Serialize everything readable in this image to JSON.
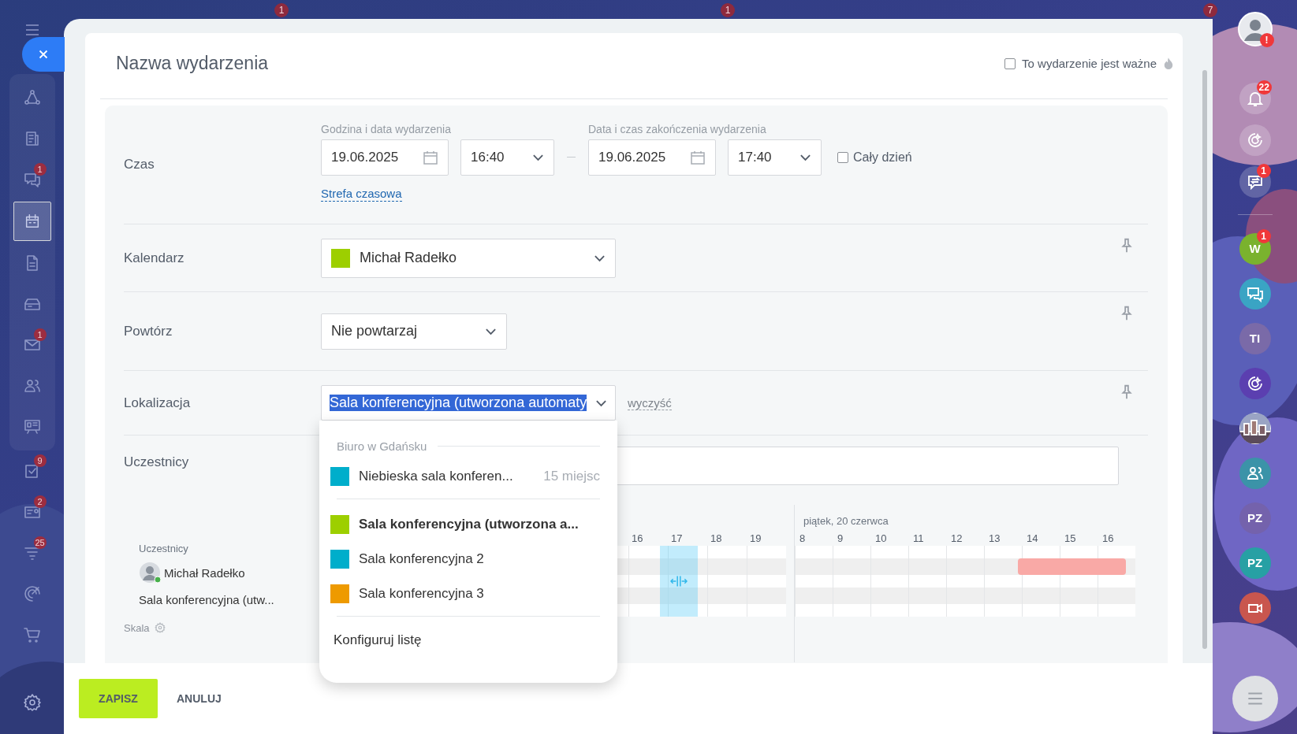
{
  "top_badges": [
    "1",
    "1",
    "7"
  ],
  "left_nav": {
    "items": [
      {
        "kind": "flow",
        "selected": false
      },
      {
        "kind": "feed",
        "selected": false
      },
      {
        "kind": "chat",
        "selected": false,
        "badge": "1"
      },
      {
        "kind": "calendar",
        "selected": true
      },
      {
        "kind": "doc",
        "selected": false
      },
      {
        "kind": "drive",
        "selected": false
      },
      {
        "kind": "mail",
        "selected": false,
        "badge": "1"
      },
      {
        "kind": "people",
        "selected": false
      },
      {
        "kind": "board",
        "selected": false
      },
      {
        "kind": "tasks",
        "selected": false,
        "badge": "9"
      },
      {
        "kind": "card",
        "selected": false,
        "badge": "2"
      },
      {
        "kind": "funnel",
        "selected": false,
        "badge": "25"
      },
      {
        "kind": "target",
        "selected": false
      },
      {
        "kind": "cart",
        "selected": false
      }
    ]
  },
  "event": {
    "title": "Nazwa wydarzenia",
    "important": {
      "label": "To wydarzenie jest ważne",
      "checked": false
    }
  },
  "time": {
    "label": "Czas",
    "start_caption": "Godzina i data wydarzenia",
    "start_date": "19.06.2025",
    "start_time": "16:40",
    "end_caption": "Data i czas zakończenia wydarzenia",
    "end_date": "19.06.2025",
    "end_time": "17:40",
    "all_day": {
      "label": "Cały dzień",
      "checked": false
    },
    "timezone_link": "Strefa czasowa"
  },
  "calendar": {
    "label": "Kalendarz",
    "value": "Michał Radełko",
    "color": "#9dcf00"
  },
  "repeat": {
    "label": "Powtórz",
    "value": "Nie powtarzaj"
  },
  "location": {
    "label": "Lokalizacja",
    "value": "Sala konferencyjna (utworzona automaty",
    "clear": "wyczyść"
  },
  "participants": {
    "label": "Uczestnicy"
  },
  "dropdown": {
    "groups": [
      {
        "title": "Biuro w Gdańsku",
        "items": [
          {
            "name": "Niebieska sala konferen...",
            "capacity": "15 miejsc",
            "color": "#00aecb",
            "selected": false
          }
        ]
      },
      {
        "items": [
          {
            "name": "Sala konferencyjna (utworzona a...",
            "color": "#9dcf00",
            "selected": true
          },
          {
            "name": "Sala konferencyjna 2",
            "color": "#00aecb",
            "selected": false
          },
          {
            "name": "Sala konferencyjna 3",
            "color": "#ee9a00",
            "selected": false
          }
        ]
      }
    ],
    "configure": "Konfiguruj listę"
  },
  "scheduler": {
    "caption": "Uczestnicy",
    "rows": [
      {
        "kind": "person",
        "name": "Michał Radełko"
      },
      {
        "kind": "room",
        "name": "Sala konferencyjna (utw..."
      }
    ],
    "day1_hours": [
      "16",
      "17",
      "18",
      "19"
    ],
    "day2_title": "piątek, 20 czerwca",
    "day2_hours": [
      "8",
      "9",
      "10",
      "11",
      "12",
      "13",
      "14",
      "15",
      "16"
    ],
    "scale_label": "Skala"
  },
  "footer": {
    "save": "ZAPISZ",
    "cancel": "ANULUJ"
  },
  "right_bar": {
    "items": [
      {
        "kind": "bell",
        "badge": "22"
      },
      {
        "kind": "copilot"
      },
      {
        "kind": "swap",
        "badge": "1"
      },
      {
        "kind": "divider"
      },
      {
        "kind": "letter",
        "text": "W",
        "color": "#7ab22e",
        "badge": "1"
      },
      {
        "kind": "chat",
        "color": "#3aa4c4"
      },
      {
        "kind": "letter",
        "text": "TI",
        "color": "#7a6aa8"
      },
      {
        "kind": "copilot",
        "color": "#5b3fb0"
      },
      {
        "kind": "picture"
      },
      {
        "kind": "people",
        "color": "#3b93a8"
      },
      {
        "kind": "letter",
        "text": "PZ",
        "color": "#7462ac"
      },
      {
        "kind": "letter",
        "text": "PZ",
        "color": "#27a0a4"
      },
      {
        "kind": "video",
        "color": "#c9564e"
      }
    ],
    "avatar_badge": "!"
  }
}
